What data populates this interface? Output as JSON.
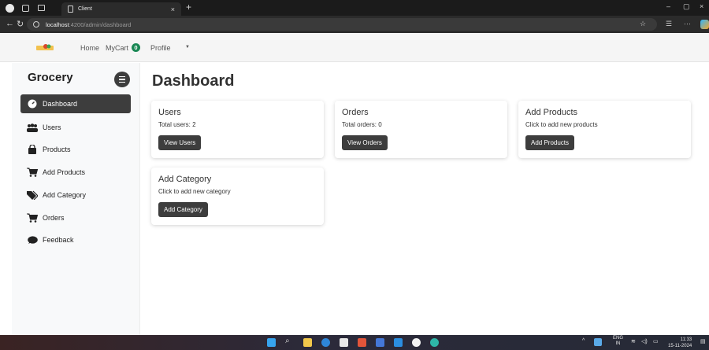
{
  "browser": {
    "tab_title": "Client",
    "tab_close": "×",
    "new_tab": "+",
    "url_host": "localhost",
    "url_path": ":4200/admin/dashboard",
    "win_min": "–",
    "win_max": "▢",
    "win_close": "×"
  },
  "navbar": {
    "home": "Home",
    "mycart": "MyCart",
    "cart_count": "0",
    "profile": "Profile",
    "caret": "▼"
  },
  "sidebar": {
    "title": "Grocery",
    "items": [
      {
        "label": "Dashboard",
        "icon": "gauge-icon"
      },
      {
        "label": "Users",
        "icon": "users-icon"
      },
      {
        "label": "Products",
        "icon": "bag-icon"
      },
      {
        "label": "Add Products",
        "icon": "cart-icon"
      },
      {
        "label": "Add Category",
        "icon": "tags-icon"
      },
      {
        "label": "Orders",
        "icon": "cart-icon"
      },
      {
        "label": "Feedback",
        "icon": "comment-icon"
      }
    ]
  },
  "main": {
    "title": "Dashboard",
    "cards": [
      {
        "title": "Users",
        "text": "Total users: 2",
        "button": "View Users"
      },
      {
        "title": "Orders",
        "text": "Total orders: 0",
        "button": "View Orders"
      },
      {
        "title": "Add Products",
        "text": "Click to add new products",
        "button": "Add Products"
      },
      {
        "title": "Add Category",
        "text": "Click to add new category",
        "button": "Add Category"
      }
    ]
  },
  "taskbar": {
    "lang_top": "ENG",
    "lang_bottom": "IN",
    "time": "11:33",
    "date": "15-11-2024"
  },
  "colors": {
    "accent": "#3d3d3d",
    "badge": "#198754"
  }
}
